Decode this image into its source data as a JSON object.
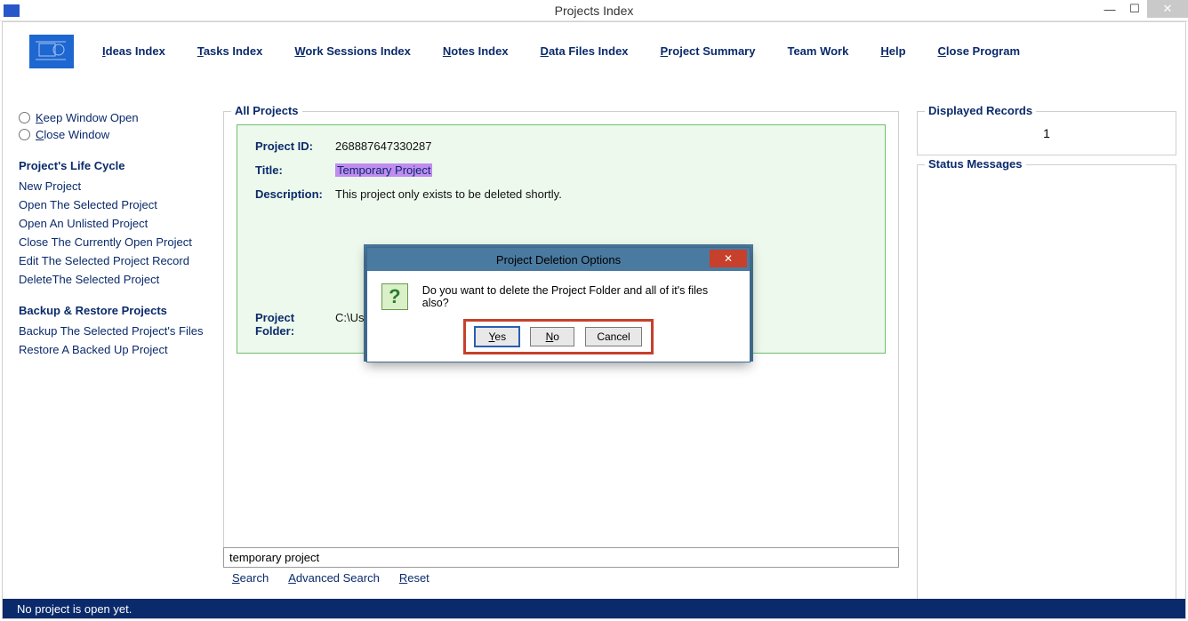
{
  "window": {
    "title": "Projects Index",
    "status": "No project is open yet."
  },
  "menu": {
    "ideas": "deas Index",
    "tasks": "asks Index",
    "work": "ork Sessions Index",
    "notes": "otes Index",
    "files": "ata Files Index",
    "summary": "roject Summary",
    "team": "Team Work",
    "help": "elp",
    "close": "lose Program"
  },
  "menu_u": {
    "ideas": "I",
    "tasks": "T",
    "work": "W",
    "notes": "N",
    "files": "D",
    "summary": "P",
    "help": "H",
    "close": "C"
  },
  "left": {
    "keep": "eep Window Open",
    "close": "lose Window",
    "section1": "Project's Life Cycle",
    "a1": "New Project",
    "a2": "Open The Selected Project",
    "a3": "Open An Unlisted Project",
    "a4": "Close The Currently Open Project",
    "a5": "Edit The Selected Project Record",
    "a6": "DeleteThe Selected Project",
    "section2": "Backup & Restore Projects",
    "b1": "Backup The Selected Project's Files",
    "b2": "Restore A Backed Up Project"
  },
  "left_u": {
    "keep": "K",
    "close": "C"
  },
  "group": {
    "legend": "All Projects",
    "id_label": "Project ID:",
    "id_value": "268887647330287",
    "title_label": "Title:",
    "title_value": "Temporary Project",
    "desc_label": "Description:",
    "desc_value": "This project only exists to be deleted shortly.",
    "folder_label": "Project\nFolder:",
    "folder_value": "C:\\Users\\"
  },
  "right": {
    "displayed_legend": "Displayed Records",
    "displayed_count": "1",
    "status_legend": "Status Messages"
  },
  "search": {
    "value": "temporary project",
    "search": "earch",
    "adv": "dvanced Search",
    "reset": "eset"
  },
  "search_u": {
    "search": "S",
    "adv": "A",
    "reset": "R"
  },
  "dialog": {
    "title": "Project Deletion Options",
    "message": "Do you want to delete the Project Folder and all of it's files also?",
    "yes": "es",
    "no": "o",
    "cancel": "Cancel"
  },
  "dialog_u": {
    "yes": "Y",
    "no": "N"
  }
}
